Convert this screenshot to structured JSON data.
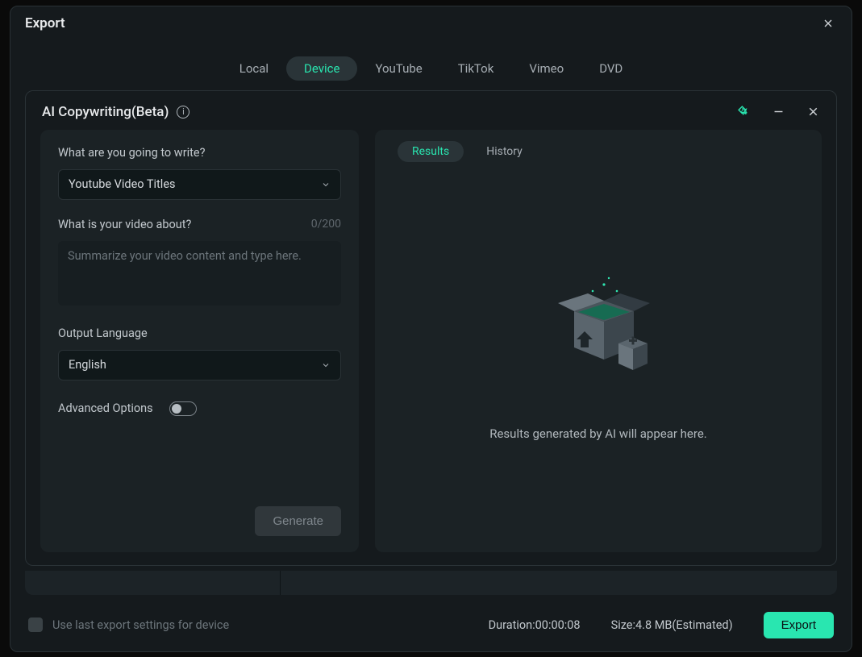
{
  "modal_title": "Export",
  "tabs": [
    "Local",
    "Device",
    "YouTube",
    "TikTok",
    "Vimeo",
    "DVD"
  ],
  "active_tab_index": 1,
  "panel": {
    "title": "AI Copywriting(Beta)",
    "left": {
      "q1_label": "What are you going to write?",
      "q1_value": "Youtube Video Titles",
      "q2_label": "What is your video about?",
      "q2_counter": "0/200",
      "q2_placeholder": "Summarize your video content and type here.",
      "lang_label": "Output Language",
      "lang_value": "English",
      "advanced_label": "Advanced Options",
      "generate_label": "Generate"
    },
    "right": {
      "subtabs": [
        "Results",
        "History"
      ],
      "active_subtab_index": 0,
      "empty_msg": "Results generated by AI will appear here."
    }
  },
  "footer": {
    "checkbox_label": "Use last export settings for device",
    "duration_label": "Duration:",
    "duration_value": "00:00:08",
    "size_label": "Size:",
    "size_value": "4.8 MB(Estimated)",
    "export_label": "Export"
  }
}
